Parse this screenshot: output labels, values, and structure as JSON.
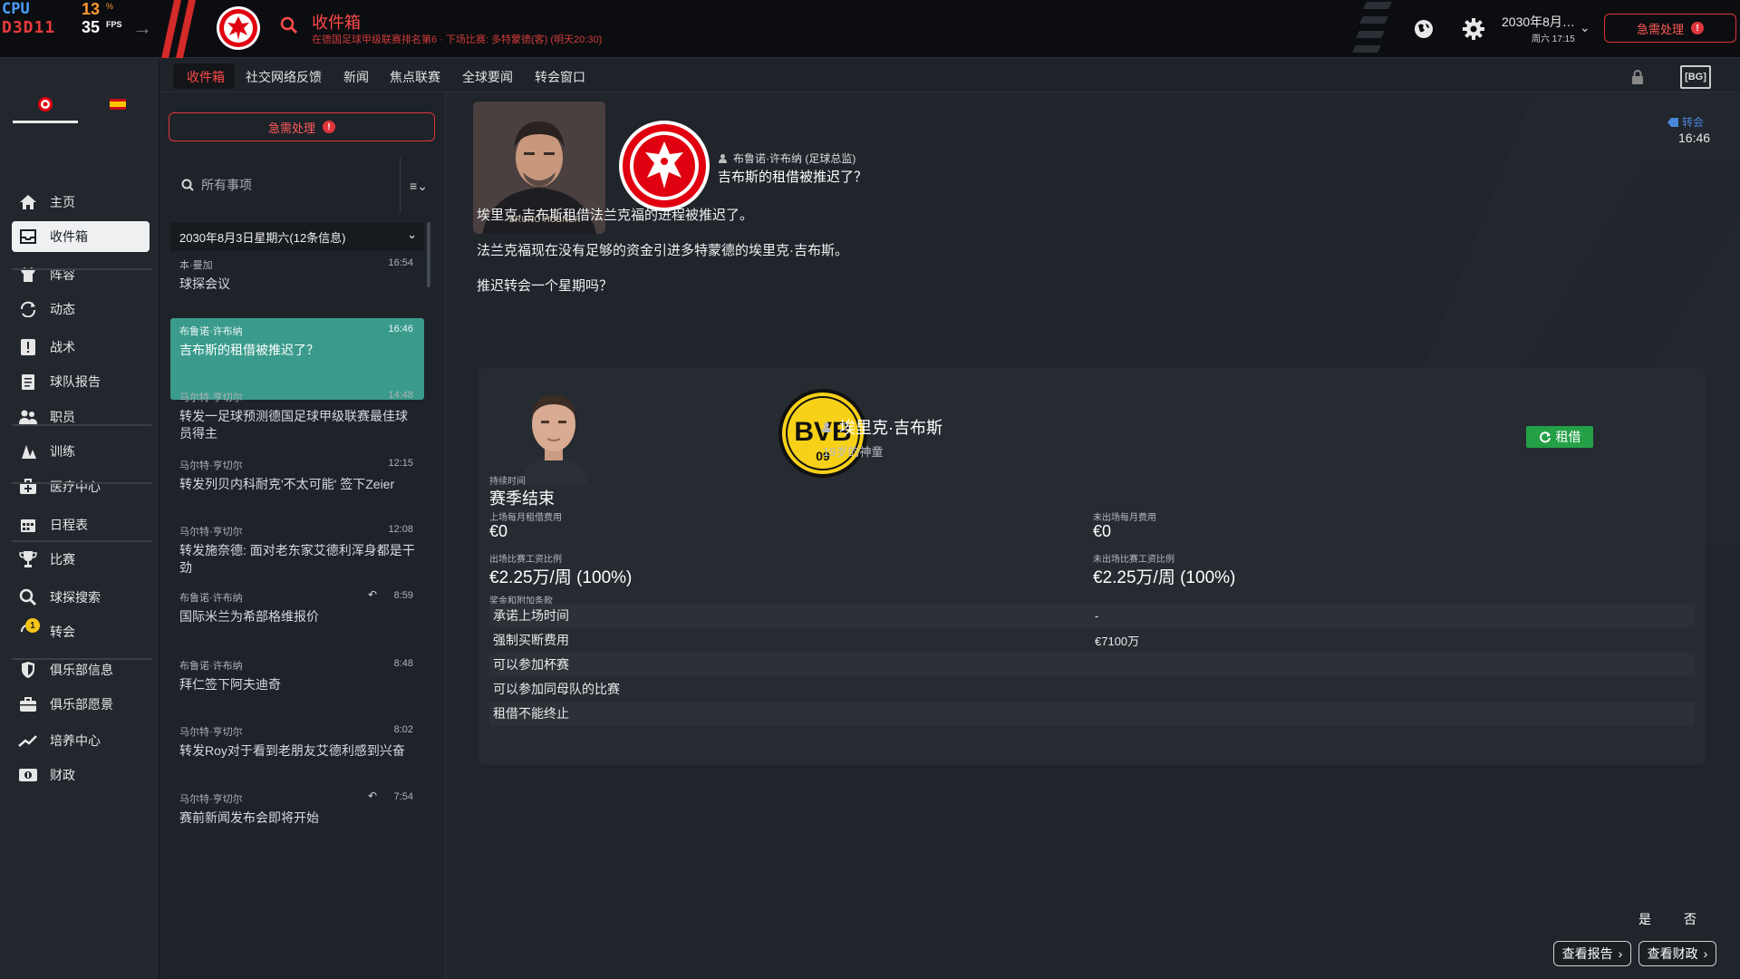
{
  "overlay": {
    "cpu_label": "CPU",
    "cpu_value": "13",
    "cpu_unit": "%",
    "api_label": "D3D11",
    "fps_value": "35",
    "fps_unit": "FPS"
  },
  "header": {
    "title": "收件箱",
    "subtitle": "在德国足球甲级联赛排名第6 · 下场比赛: 多特蒙德(客) (明天20:30)",
    "date_main": "2030年8月…",
    "date_sub": "周六 17:15",
    "urgent_label": "急需处理",
    "urgent_mark": "!"
  },
  "sidebar": {
    "items": [
      {
        "label": "主页",
        "icon": "home-icon"
      },
      {
        "label": "收件箱",
        "icon": "inbox-icon"
      },
      {
        "label": "阵容",
        "icon": "squad-shirt-icon"
      },
      {
        "label": "动态",
        "icon": "dynamics-icon"
      },
      {
        "label": "战术",
        "icon": "tactics-icon"
      },
      {
        "label": "球队报告",
        "icon": "report-icon"
      },
      {
        "label": "职员",
        "icon": "staff-icon"
      },
      {
        "label": "训练",
        "icon": "training-icon"
      },
      {
        "label": "医疗中心",
        "icon": "medical-icon"
      },
      {
        "label": "日程表",
        "icon": "calendar-icon"
      },
      {
        "label": "比赛",
        "icon": "trophy-icon"
      },
      {
        "label": "球探搜索",
        "icon": "scout-search-icon"
      },
      {
        "label": "转会",
        "icon": "transfer-icon"
      },
      {
        "label": "俱乐部信息",
        "icon": "club-shield-icon"
      },
      {
        "label": "俱乐部愿景",
        "icon": "vision-icon"
      },
      {
        "label": "培养中心",
        "icon": "development-icon"
      },
      {
        "label": "财政",
        "icon": "finance-icon"
      }
    ],
    "transfer_badge": "1"
  },
  "subtabs": [
    "收件箱",
    "社交网络反馈",
    "新闻",
    "焦点联赛",
    "全球要闻",
    "转会窗口"
  ],
  "subtab_fb_label": "[BG]",
  "list": {
    "urgent_label": "急需处理",
    "search_placeholder": "所有事项",
    "filter_label": "≡⌄",
    "date_group": "2030年8月3日星期六(12条信息)",
    "messages": [
      {
        "sender": "本·曼加",
        "time": "16:54",
        "subject": "球探会议"
      },
      {
        "sender": "布鲁诺·许布纳",
        "time": "16:46",
        "subject": "吉布斯的租借被推迟了？"
      },
      {
        "sender": "马尔特·亨切尔",
        "time": "14:48",
        "subject": "转发一足球预测德国足球甲级联赛最佳球员得主"
      },
      {
        "sender": "马尔特·亨切尔",
        "time": "12:15",
        "subject": "转发列贝内科耐克'不太可能' 签下Zeier"
      },
      {
        "sender": "马尔特·亨切尔",
        "time": "12:08",
        "subject": "转发施奈德: 面对老东家艾德利浑身都是干劲"
      },
      {
        "sender": "布鲁诺·许布纳",
        "time": "8:59",
        "subject": "国际米兰为希部格维报价"
      },
      {
        "sender": "布鲁诺·许布纳",
        "time": "8:48",
        "subject": "拜仁签下阿夫迪奇"
      },
      {
        "sender": "马尔特·亨切尔",
        "time": "8:02",
        "subject": "转发Roy对于看到老朋友艾德利感到兴奋"
      },
      {
        "sender": "马尔特·亨切尔",
        "time": "7:54",
        "subject": "赛前新闻发布会即将开始"
      }
    ]
  },
  "detail": {
    "photo_caption": "BRUNO HÜBNER",
    "from": "布鲁诺·许布纳 (足球总监)",
    "title": "吉布斯的租借被推迟了？",
    "tag": "转会",
    "time": "16:46",
    "body": [
      "埃里克·吉布斯租借法兰克福的进程被推迟了。",
      "法兰克福现在没有足够的资金引进多特蒙德的埃里克·吉布斯。",
      "推迟转会一个星期吗？"
    ],
    "player": {
      "name": "埃里克·吉布斯",
      "desc": "19岁的神童",
      "deal_type": "租借",
      "duration_label": "持续时间",
      "duration_value": "赛季结束",
      "fee_played_label": "上场每月租借费用",
      "fee_played_value": "€0",
      "fee_unplayed_label": "未出场每月费用",
      "fee_unplayed_value": "€0",
      "wage_played_label": "出场比赛工资比例",
      "wage_played_value": "€2.25万/周 (100%)",
      "wage_unplayed_label": "未出场比赛工资比例",
      "wage_unplayed_value": "€2.25万/周 (100%)",
      "bonus_label": "奖金和附加条款"
    },
    "terms": [
      {
        "label": "承诺上场时间",
        "value": "-"
      },
      {
        "label": "强制买断费用",
        "value": "€7100万"
      },
      {
        "label": "可以参加杯赛",
        "value": ""
      },
      {
        "label": "可以参加同母队的比赛",
        "value": ""
      },
      {
        "label": "租借不能终止",
        "value": ""
      }
    ],
    "yes_label": "是",
    "no_label": "否",
    "view_report_label": "查看报告",
    "view_finance_label": "查看财政"
  },
  "colors": {
    "accent_red": "#e0353a",
    "selected_message": "#3a9b8c",
    "loan_green": "#24a047",
    "bvb_yellow": "#f7d117"
  }
}
